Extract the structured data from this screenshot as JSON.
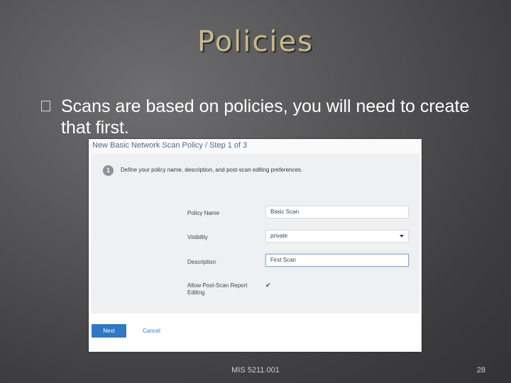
{
  "slide": {
    "title": "Policies",
    "bullet_icon": "box-glyph",
    "bullet_text": "Scans are based on policies, you will need to create that first.",
    "footer": "MIS 5211.001",
    "page_number": "28"
  },
  "screenshot": {
    "header": "New Basic Network Scan Policy / Step 1 of 3",
    "step_number": "1",
    "step_text": "Define your policy name, description, and post-scan editing preferences.",
    "fields": {
      "policy_name_label": "Policy Name",
      "policy_name_value": "Basic Scan",
      "visibility_label": "Visibility",
      "visibility_value": "private",
      "description_label": "Description",
      "description_value": "First Scan",
      "post_scan_label": "Allow Post-Scan Report Editing",
      "post_scan_checked": true,
      "check_glyph": "✔"
    },
    "buttons": {
      "next": "Next",
      "cancel": "Cancel"
    },
    "colors": {
      "primary": "#2f78c4",
      "title": "#c9b98a"
    }
  }
}
